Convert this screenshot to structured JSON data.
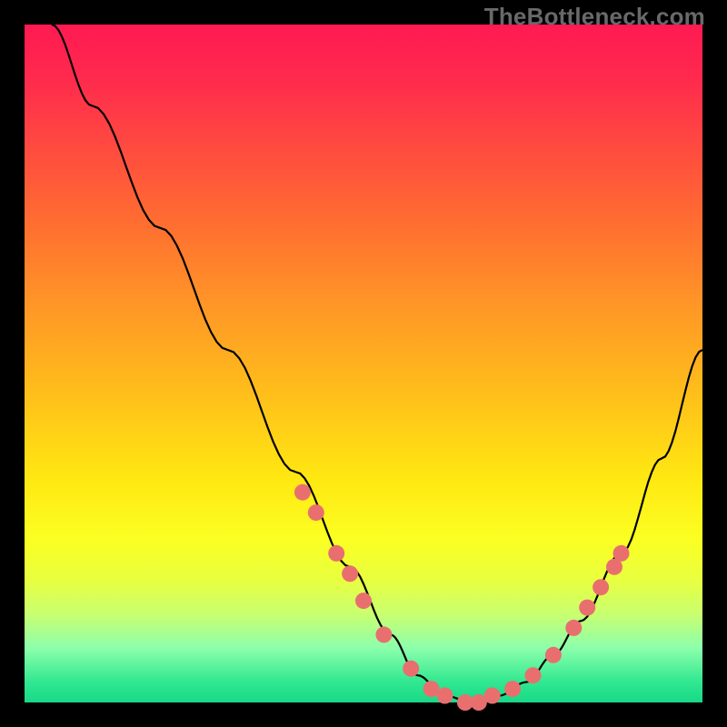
{
  "watermark": "TheBottleneck.com",
  "colors": {
    "curve": "#000000",
    "marker_fill": "#e96f6f",
    "marker_stroke": "#c95858",
    "background": "#000000"
  },
  "chart_data": {
    "type": "line",
    "title": "",
    "xlabel": "",
    "ylabel": "",
    "xlim": [
      0,
      100
    ],
    "ylim": [
      0,
      100
    ],
    "grid": false,
    "series": [
      {
        "name": "curve",
        "x": [
          4,
          10,
          20,
          30,
          40,
          48,
          54,
          58,
          62,
          66,
          70,
          74,
          78,
          82,
          88,
          94,
          100
        ],
        "y": [
          100,
          88,
          70,
          52,
          34,
          20,
          10,
          4,
          1,
          0,
          1,
          3,
          7,
          12,
          22,
          36,
          52
        ]
      }
    ],
    "markers": [
      {
        "x": 41,
        "y": 31
      },
      {
        "x": 43,
        "y": 28
      },
      {
        "x": 46,
        "y": 22
      },
      {
        "x": 48,
        "y": 19
      },
      {
        "x": 50,
        "y": 15
      },
      {
        "x": 53,
        "y": 10
      },
      {
        "x": 57,
        "y": 5
      },
      {
        "x": 60,
        "y": 2
      },
      {
        "x": 62,
        "y": 1
      },
      {
        "x": 65,
        "y": 0
      },
      {
        "x": 67,
        "y": 0
      },
      {
        "x": 69,
        "y": 1
      },
      {
        "x": 72,
        "y": 2
      },
      {
        "x": 75,
        "y": 4
      },
      {
        "x": 78,
        "y": 7
      },
      {
        "x": 81,
        "y": 11
      },
      {
        "x": 83,
        "y": 14
      },
      {
        "x": 85,
        "y": 17
      },
      {
        "x": 87,
        "y": 20
      },
      {
        "x": 88,
        "y": 22
      }
    ]
  }
}
